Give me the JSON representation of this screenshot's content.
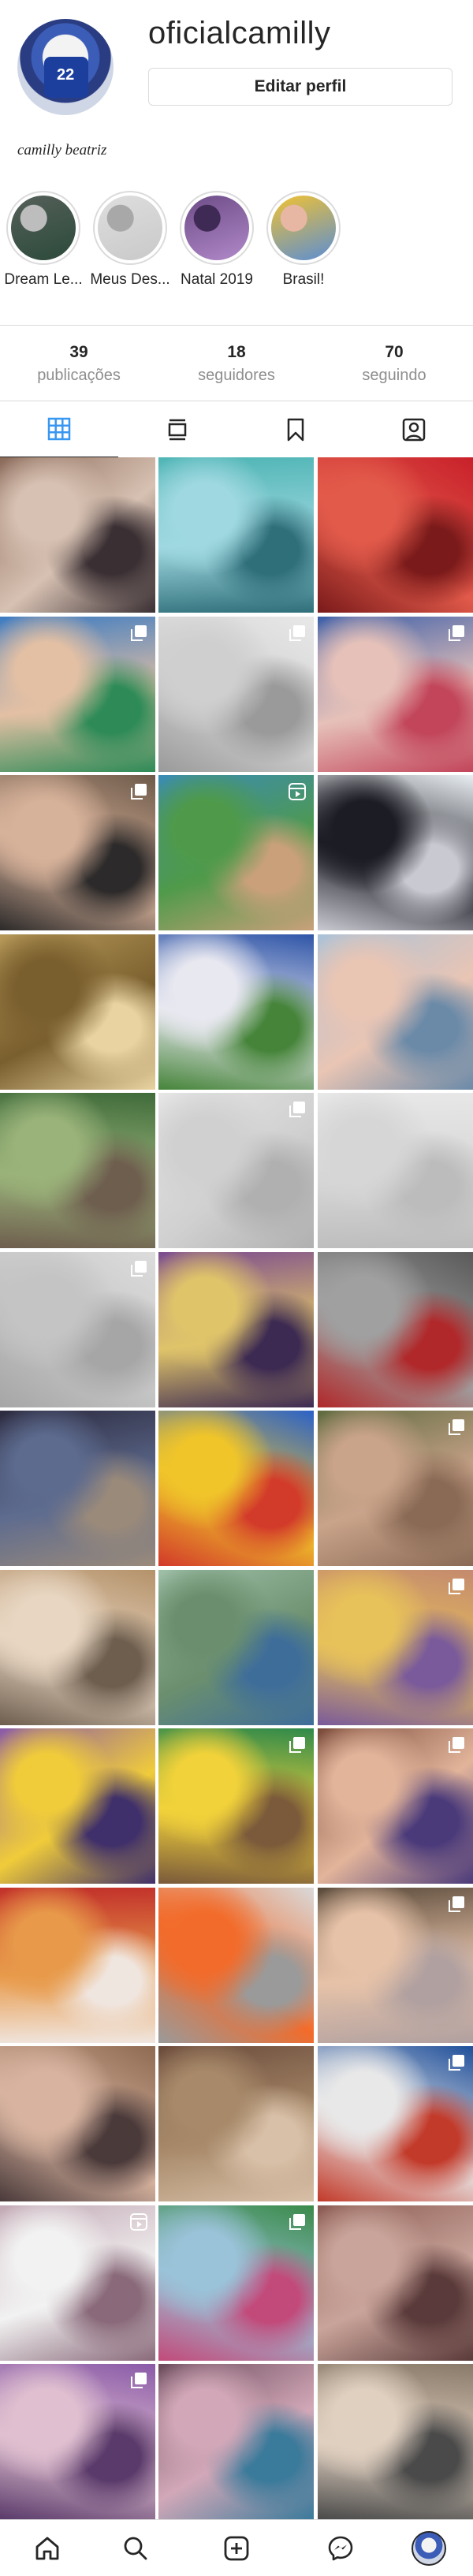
{
  "profile": {
    "username": "oficialcamilly",
    "edit_label": "Editar perfil",
    "bio_name": "camilly beatriz"
  },
  "highlights": [
    {
      "label": "Dream Le...",
      "colors": [
        "#56605a",
        "#2b4a3a",
        "#bdbdbd"
      ]
    },
    {
      "label": "Meus Des...",
      "colors": [
        "#dedede",
        "#c9c9c9",
        "#a8a8a8"
      ]
    },
    {
      "label": "Natal 2019",
      "colors": [
        "#6d4c87",
        "#b189c9",
        "#3e2a55"
      ]
    },
    {
      "label": "Brasil!",
      "colors": [
        "#f1c232",
        "#5a8ed4",
        "#e8b7a3"
      ]
    }
  ],
  "stats": [
    {
      "number": "39",
      "label": "publicações"
    },
    {
      "number": "18",
      "label": "seguidores"
    },
    {
      "number": "70",
      "label": "seguindo"
    }
  ],
  "tabs": [
    {
      "name": "tab-grid",
      "icon": "grid-icon",
      "active": true
    },
    {
      "name": "tab-feed",
      "icon": "feed-icon",
      "active": false
    },
    {
      "name": "tab-saved",
      "icon": "bookmark-icon",
      "active": false
    },
    {
      "name": "tab-tagged",
      "icon": "tagged-user-icon",
      "active": false
    }
  ],
  "posts": [
    {
      "colors": [
        "#8b6a5a",
        "#d7c1b2",
        "#3a2f33"
      ],
      "badge": ""
    },
    {
      "colors": [
        "#4fb5b5",
        "#9fd8e0",
        "#2f6f7a"
      ],
      "badge": ""
    },
    {
      "colors": [
        "#c8202a",
        "#e25a4a",
        "#7a1a1a"
      ],
      "badge": ""
    },
    {
      "colors": [
        "#3c7bc2",
        "#e3c0a4",
        "#2e8b57"
      ],
      "badge": "multi"
    },
    {
      "colors": [
        "#e8e8e8",
        "#cfcfcf",
        "#9a9a9a"
      ],
      "badge": "multi"
    },
    {
      "colors": [
        "#3b5ea8",
        "#e6c1b9",
        "#c2455a"
      ],
      "badge": "multi"
    },
    {
      "colors": [
        "#6e5a4a",
        "#d7b29a",
        "#2c2a2a"
      ],
      "badge": "multi"
    },
    {
      "colors": [
        "#3a8bb7",
        "#4f9a4a",
        "#c9a07a"
      ],
      "badge": "video"
    },
    {
      "colors": [
        "#e9eef2",
        "#1c1c24",
        "#c9c9d2"
      ],
      "badge": ""
    },
    {
      "colors": [
        "#b79a5a",
        "#7a5f2e",
        "#e8d3a1"
      ],
      "badge": ""
    },
    {
      "colors": [
        "#2f55a8",
        "#e8e8f0",
        "#46843a"
      ],
      "badge": ""
    },
    {
      "colors": [
        "#a9c2d9",
        "#e9c5b4",
        "#6b8aa8"
      ],
      "badge": ""
    },
    {
      "colors": [
        "#3f6b3a",
        "#9ab37a",
        "#6e5e4e"
      ],
      "badge": ""
    },
    {
      "colors": [
        "#e6e6e6",
        "#d0d0d0",
        "#b0b0b0"
      ],
      "badge": "multi"
    },
    {
      "colors": [
        "#e8e8e8",
        "#d6d6d6",
        "#bcbcbc"
      ],
      "badge": ""
    },
    {
      "colors": [
        "#dcdcdc",
        "#c4c4c4",
        "#a6a6a6"
      ],
      "badge": "multi"
    },
    {
      "colors": [
        "#7a4b8f",
        "#e0c46a",
        "#3d2a52"
      ],
      "badge": ""
    },
    {
      "colors": [
        "#5a5a5a",
        "#a0a0a0",
        "#b0282a"
      ],
      "badge": ""
    },
    {
      "colors": [
        "#2c2a3e",
        "#5d6b8f",
        "#9a8a7a"
      ],
      "badge": ""
    },
    {
      "colors": [
        "#2b62c8",
        "#f0c52a",
        "#d23a2a"
      ],
      "badge": ""
    },
    {
      "colors": [
        "#5e6a3e",
        "#c9a38a",
        "#8a6a55"
      ],
      "badge": "multi"
    },
    {
      "colors": [
        "#b4926a",
        "#e8d6c2",
        "#6e5e4e"
      ],
      "badge": ""
    },
    {
      "colors": [
        "#9fc0a8",
        "#6b8f6e",
        "#3e6d9a"
      ],
      "badge": ""
    },
    {
      "colors": [
        "#c48a6e",
        "#e7c15a",
        "#7a5a9a"
      ],
      "badge": "multi"
    },
    {
      "colors": [
        "#8a5aa8",
        "#f0cc3a",
        "#3f2f6a"
      ],
      "badge": ""
    },
    {
      "colors": [
        "#2f8a4a",
        "#f2d23a",
        "#7a5a3a"
      ],
      "badge": "multi"
    },
    {
      "colors": [
        "#7a4a3a",
        "#e2b49a",
        "#4a3a7a"
      ],
      "badge": "multi"
    },
    {
      "colors": [
        "#c2302a",
        "#e89a4a",
        "#f0e6e0"
      ],
      "badge": ""
    },
    {
      "colors": [
        "#d9d9d9",
        "#f26b2a",
        "#9a9a9a"
      ],
      "badge": ""
    },
    {
      "colors": [
        "#5a4a3a",
        "#e6c2a8",
        "#b0a0a0"
      ],
      "badge": "multi"
    },
    {
      "colors": [
        "#8e6a52",
        "#d8b4a0",
        "#4a3a3a"
      ],
      "badge": ""
    },
    {
      "colors": [
        "#6a4a3a",
        "#a88a6a",
        "#d8c0a8"
      ],
      "badge": ""
    },
    {
      "colors": [
        "#1f4f9a",
        "#e8e8e8",
        "#c23a2a"
      ],
      "badge": "multi"
    },
    {
      "colors": [
        "#c2a8b4",
        "#f2f2f2",
        "#8a6a7a"
      ],
      "badge": "video"
    },
    {
      "colors": [
        "#3a8a4a",
        "#9ac2d8",
        "#c24a7a"
      ],
      "badge": "multi"
    },
    {
      "colors": [
        "#8a5a52",
        "#c9a49a",
        "#5a3a3a"
      ],
      "badge": ""
    },
    {
      "colors": [
        "#8a5aa8",
        "#e0c0d0",
        "#5a3a6a"
      ],
      "badge": "multi"
    },
    {
      "colors": [
        "#6a4a5a",
        "#d2a8b8",
        "#3a7a9a"
      ],
      "badge": ""
    },
    {
      "colors": [
        "#8a7a6a",
        "#e0d0c0",
        "#4a4a4a"
      ],
      "badge": ""
    }
  ],
  "bottom_nav": [
    {
      "name": "nav-home",
      "icon": "home-icon"
    },
    {
      "name": "nav-search",
      "icon": "search-icon"
    },
    {
      "name": "nav-new-post",
      "icon": "add-post-icon"
    },
    {
      "name": "nav-messenger",
      "icon": "messenger-icon"
    },
    {
      "name": "nav-profile",
      "icon": "profile-avatar"
    }
  ]
}
